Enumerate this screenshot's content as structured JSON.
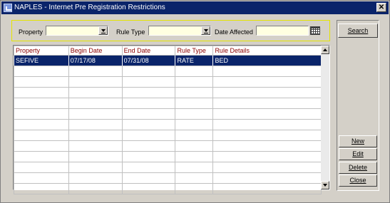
{
  "window": {
    "title": "NAPLES - Internet Pre Registration Restrictions",
    "close_glyph": "✕"
  },
  "filters": {
    "property_label": "Property",
    "property_value": "",
    "rule_type_label": "Rule Type",
    "rule_type_value": "",
    "date_affected_label": "Date Affected",
    "date_affected_value": ""
  },
  "grid": {
    "columns": [
      "Property",
      "Begin Date",
      "End Date",
      "Rule Type",
      "Rule Details"
    ],
    "rows": [
      [
        "SEFIVE",
        "07/17/08",
        "07/31/08",
        "RATE",
        "BED"
      ],
      [
        "",
        "",
        "",
        "",
        ""
      ],
      [
        "",
        "",
        "",
        "",
        ""
      ],
      [
        "",
        "",
        "",
        "",
        ""
      ],
      [
        "",
        "",
        "",
        "",
        ""
      ],
      [
        "",
        "",
        "",
        "",
        ""
      ],
      [
        "",
        "",
        "",
        "",
        ""
      ],
      [
        "",
        "",
        "",
        "",
        ""
      ],
      [
        "",
        "",
        "",
        "",
        ""
      ],
      [
        "",
        "",
        "",
        "",
        ""
      ],
      [
        "",
        "",
        "",
        "",
        ""
      ],
      [
        "",
        "",
        "",
        "",
        ""
      ],
      [
        "",
        "",
        "",
        "",
        ""
      ]
    ],
    "selected_row": 0
  },
  "buttons": {
    "search": "Search",
    "new": "New",
    "edit": "Edit",
    "delete": "Delete",
    "close": "Close"
  },
  "colors": {
    "titlebar": "#0a246a",
    "header_text": "#8b0000",
    "field_bg": "#ffffe1",
    "selection": "#0a246a"
  }
}
